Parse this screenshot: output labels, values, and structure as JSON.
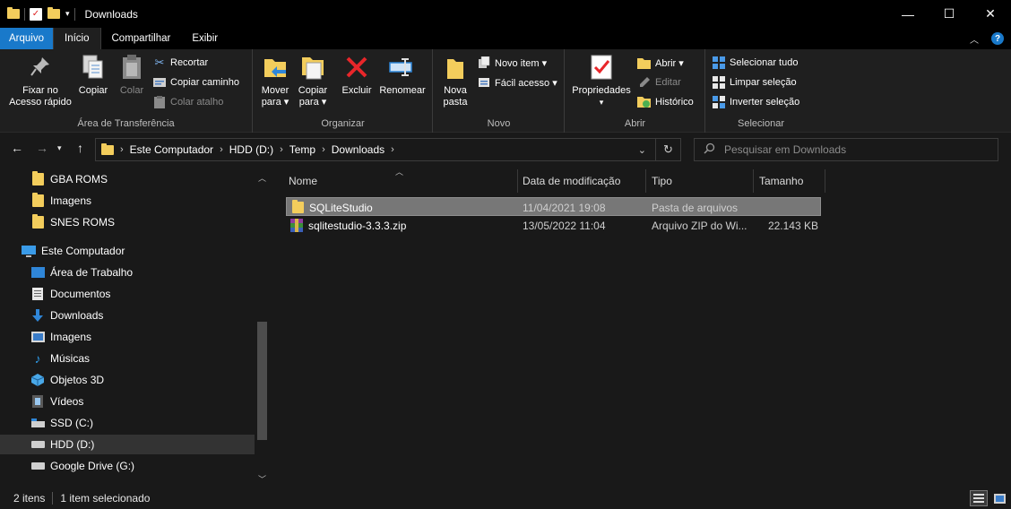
{
  "window": {
    "title": "Downloads",
    "minimize": "—",
    "maximize": "☐",
    "close": "✕"
  },
  "tabs": {
    "file": "Arquivo",
    "home": "Início",
    "share": "Compartilhar",
    "view": "Exibir"
  },
  "ribbon": {
    "pin": "Fixar no\nAcesso rápido",
    "pin_line1": "Fixar no",
    "pin_line2": "Acesso rápido",
    "copy": "Copiar",
    "paste": "Colar",
    "cut": "Recortar",
    "copy_path": "Copiar caminho",
    "paste_shortcut": "Colar atalho",
    "clipboard_group": "Área de Transferência",
    "move_line1": "Mover",
    "move_line2": "para",
    "copyto_line1": "Copiar",
    "copyto_line2": "para",
    "delete": "Excluir",
    "rename": "Renomear",
    "organize_group": "Organizar",
    "new_folder_line1": "Nova",
    "new_folder_line2": "pasta",
    "new_item": "Novo item",
    "easy_access": "Fácil acesso",
    "new_group": "Novo",
    "properties": "Propriedades",
    "open": "Abrir",
    "edit": "Editar",
    "history": "Histórico",
    "open_group": "Abrir",
    "select_all": "Selecionar tudo",
    "select_none": "Limpar seleção",
    "invert_selection": "Inverter seleção",
    "select_group": "Selecionar"
  },
  "address": {
    "breadcrumb": [
      "Este Computador",
      "HDD (D:)",
      "Temp",
      "Downloads"
    ],
    "search_placeholder": "Pesquisar em Downloads"
  },
  "navpane": {
    "items": [
      {
        "label": "GBA ROMS",
        "icon": "folder-icon"
      },
      {
        "label": "Imagens",
        "icon": "folder-icon"
      },
      {
        "label": "SNES ROMS",
        "icon": "folder-icon"
      },
      {
        "label": "Este Computador",
        "icon": "computer-icon"
      },
      {
        "label": "Área de Trabalho",
        "icon": "desktop-icon"
      },
      {
        "label": "Documentos",
        "icon": "documents-icon"
      },
      {
        "label": "Downloads",
        "icon": "download-icon"
      },
      {
        "label": "Imagens",
        "icon": "pictures-icon"
      },
      {
        "label": "Músicas",
        "icon": "music-icon"
      },
      {
        "label": "Objetos 3D",
        "icon": "objects-3d-icon"
      },
      {
        "label": "Vídeos",
        "icon": "videos-icon"
      },
      {
        "label": "SSD (C:)",
        "icon": "drive-icon"
      },
      {
        "label": "HDD (D:)",
        "icon": "drive-icon"
      },
      {
        "label": "Google Drive (G:)",
        "icon": "drive-icon"
      }
    ]
  },
  "filelist": {
    "columns": {
      "name": "Nome",
      "modified": "Data de modificação",
      "type": "Tipo",
      "size": "Tamanho"
    },
    "rows": [
      {
        "name": "SQLiteStudio",
        "modified": "11/04/2021 19:08",
        "type": "Pasta de arquivos",
        "size": ""
      },
      {
        "name": "sqlitestudio-3.3.3.zip",
        "modified": "13/05/2022 11:04",
        "type": "Arquivo ZIP do Wi...",
        "size": "22.143 KB"
      }
    ]
  },
  "status": {
    "item_count": "2 itens",
    "selected": "1 item selecionado"
  },
  "colors": {
    "accent": "#1979ca",
    "folder": "#f3cd5c",
    "background": "#191919"
  }
}
